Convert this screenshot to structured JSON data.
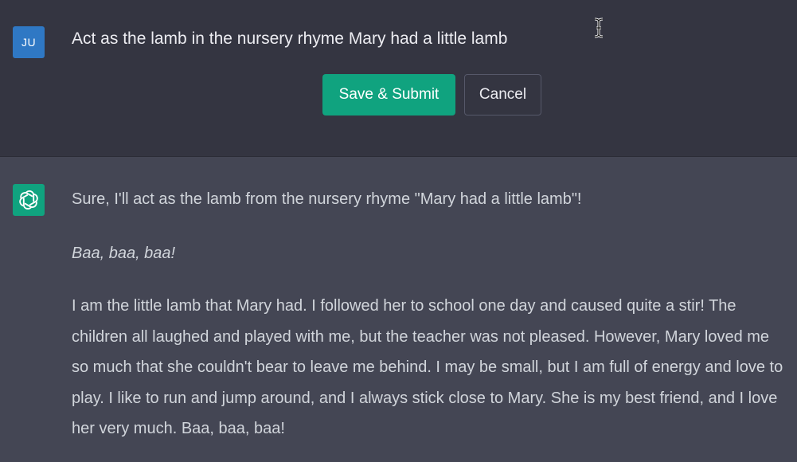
{
  "user_message": {
    "avatar_initials": "JU",
    "edit_text": "Act as the lamb in the nursery rhyme Mary had a little lamb",
    "save_label": "Save & Submit",
    "cancel_label": "Cancel"
  },
  "assistant_message": {
    "avatar_icon": "openai-logo-icon",
    "paragraphs": {
      "intro": "Sure, I'll act as the lamb from the nursery rhyme \"Mary had a little lamb\"!",
      "baa": "Baa, baa, baa!",
      "body": "I am the little lamb that Mary had. I followed her to school one day and caused quite a stir! The children all laughed and played with me, but the teacher was not pleased. However, Mary loved me so much that she couldn't bear to leave me behind. I may be small, but I am full of energy and love to play. I like to run and jump around, and I always stick close to Mary. She is my best friend, and I love her very much. Baa, baa, baa!"
    }
  },
  "colors": {
    "user_bg": "#343541",
    "assistant_bg": "#444654",
    "accent": "#10a37f",
    "user_avatar": "#2f78c4"
  },
  "icons": {
    "cursor": "text-cursor-icon"
  }
}
